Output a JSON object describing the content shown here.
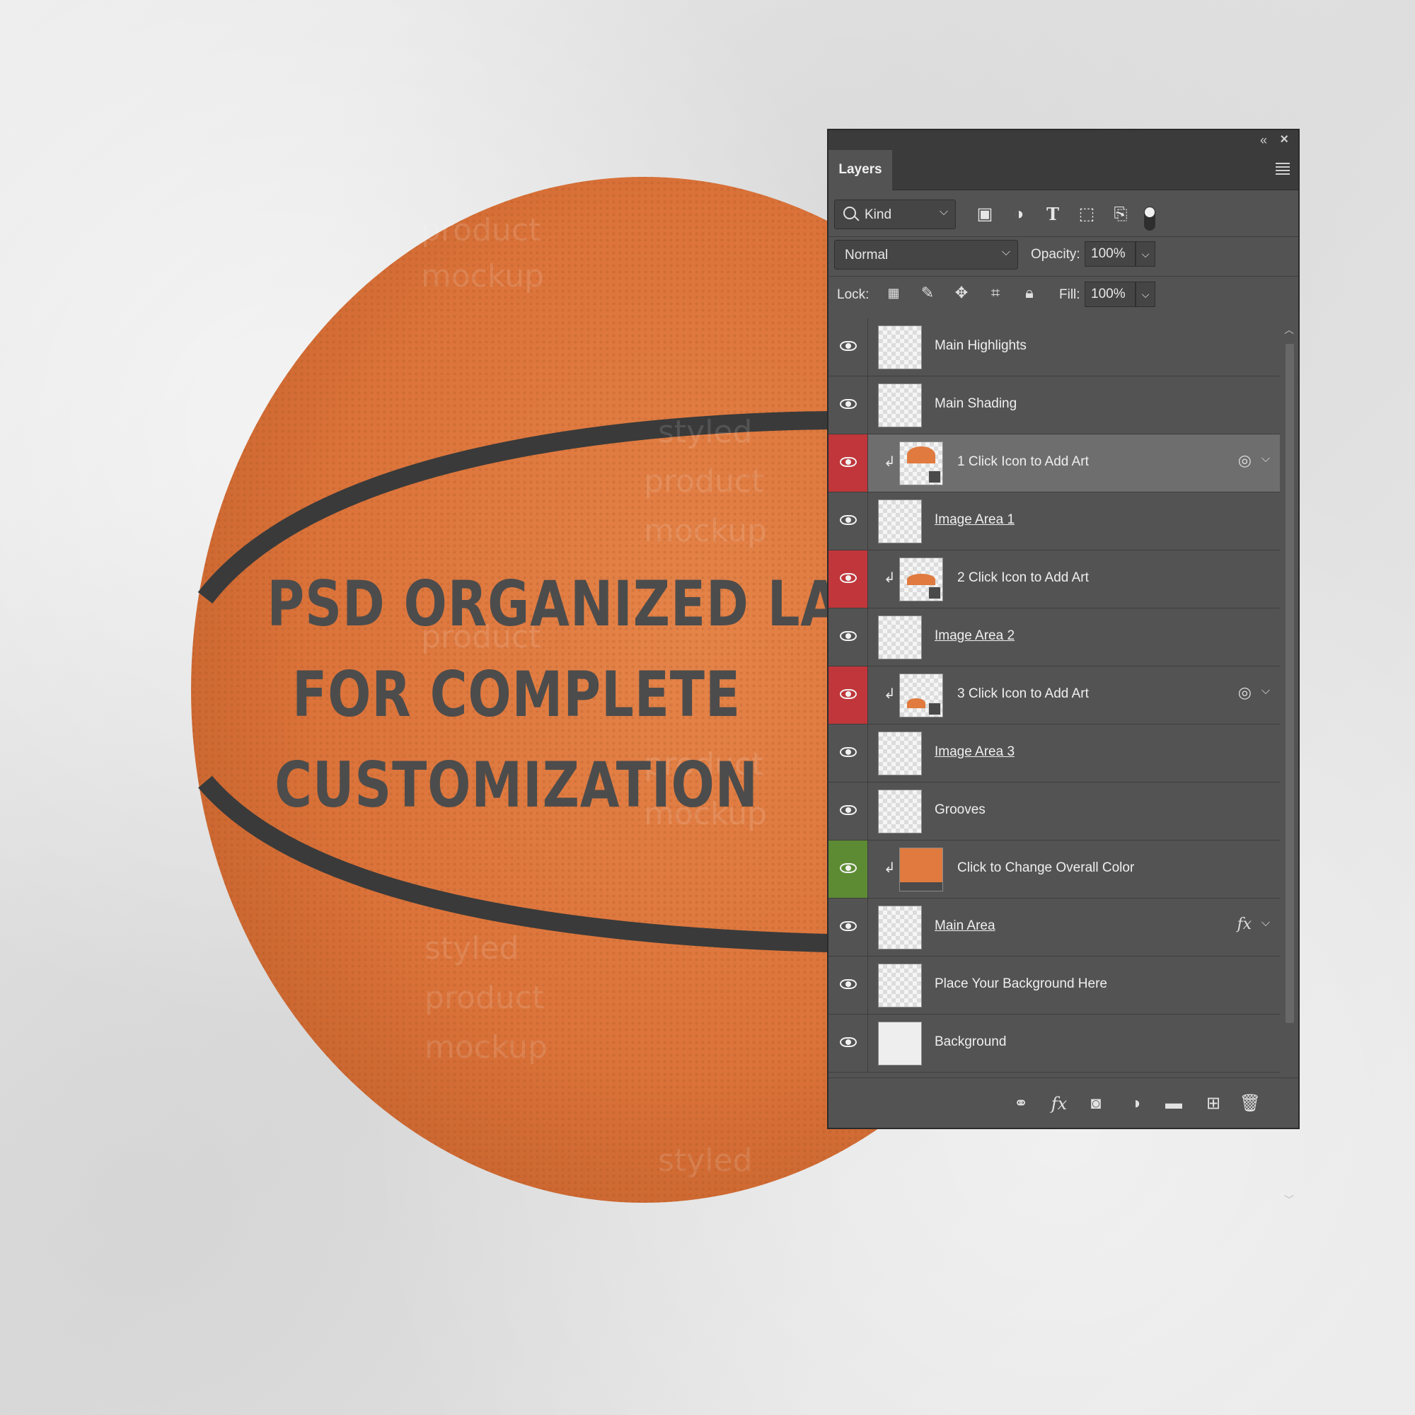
{
  "headline": {
    "line1": "PSD ORGANIZED LAYERS",
    "line2": "FOR COMPLETE",
    "line3": "CUSTOMIZATION"
  },
  "watermark": {
    "line1": "styled",
    "line2": "product",
    "line3": "mockup"
  },
  "colors": {
    "ball_orange": "#e07a3e",
    "ball_seam": "#3a3a3a",
    "panel_bg": "#535353",
    "red_marker": "#c0363a",
    "green_marker": "#5d8b33",
    "headline_text": "#4c4c4c"
  },
  "panel": {
    "tab_label": "Layers",
    "kind_filter": {
      "icon": "search-icon",
      "label": "Kind"
    },
    "blend_mode": "Normal",
    "opacity_label": "Opacity:",
    "opacity_value": "100%",
    "lock_label": "Lock:",
    "fill_label": "Fill:",
    "fill_value": "100%",
    "layers": [
      {
        "name": "Main Highlights",
        "marker": "none",
        "underline": false,
        "clipped": false,
        "thumb": "transparent"
      },
      {
        "name": "Main Shading",
        "marker": "none",
        "underline": false,
        "clipped": false,
        "thumb": "transparent"
      },
      {
        "name": "1 Click Icon to Add Art",
        "marker": "red",
        "underline": false,
        "clipped": true,
        "thumb": "smart",
        "selected": true,
        "right_icon": "link-circle-icon"
      },
      {
        "name": "Image Area 1",
        "marker": "none",
        "underline": true,
        "clipped": false,
        "thumb": "transparent"
      },
      {
        "name": "2 Click Icon to Add Art",
        "marker": "red",
        "underline": false,
        "clipped": true,
        "thumb": "smart"
      },
      {
        "name": "Image Area 2",
        "marker": "none",
        "underline": true,
        "clipped": false,
        "thumb": "transparent"
      },
      {
        "name": "3 Click Icon to Add Art",
        "marker": "red",
        "underline": false,
        "clipped": true,
        "thumb": "smart",
        "right_icon": "link-circle-icon"
      },
      {
        "name": "Image Area 3",
        "marker": "none",
        "underline": true,
        "clipped": false,
        "thumb": "transparent"
      },
      {
        "name": "Grooves",
        "marker": "none",
        "underline": false,
        "clipped": false,
        "thumb": "transparent"
      },
      {
        "name": "Click to Change Overall Color",
        "marker": "green",
        "underline": false,
        "clipped": true,
        "thumb": "fill"
      },
      {
        "name": "Main Area",
        "marker": "none",
        "underline": true,
        "clipped": false,
        "thumb": "transparent",
        "right_icon": "fx-icon"
      },
      {
        "name": "Place Your Background Here",
        "marker": "none",
        "underline": false,
        "clipped": false,
        "thumb": "transparent"
      },
      {
        "name": "Background",
        "marker": "none",
        "underline": false,
        "clipped": false,
        "thumb": "plain"
      }
    ]
  }
}
